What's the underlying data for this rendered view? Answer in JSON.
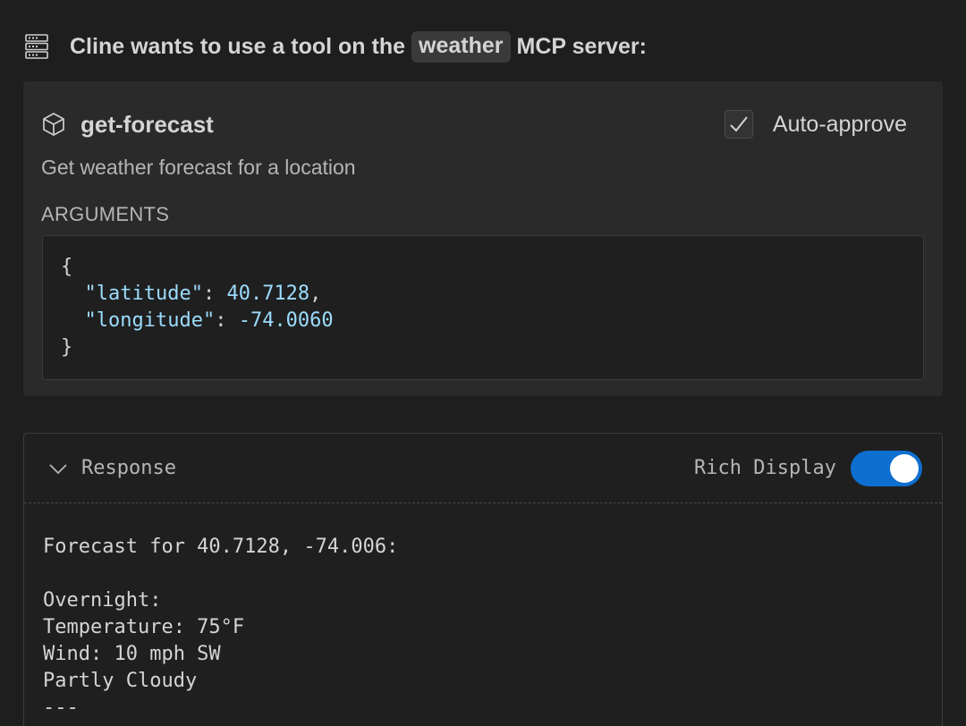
{
  "header": {
    "icon": "server-icon",
    "title_prefix": "Cline wants to use a tool on the",
    "server_name": "weather",
    "title_suffix": "MCP server:"
  },
  "tool": {
    "icon": "cube-icon",
    "name": "get-forecast",
    "description": "Get weather forecast for a location",
    "auto_approve_label": "Auto-approve",
    "auto_approve_checked": true,
    "arguments_label": "ARGUMENTS",
    "arguments": {
      "open": "{",
      "lat_key": "\"latitude\"",
      "lat_value": "40.7128",
      "lon_key": "\"longitude\"",
      "lon_value": "-74.0060",
      "close": "}"
    }
  },
  "response": {
    "title": "Response",
    "rich_display_label": "Rich Display",
    "rich_display_on": true,
    "lines": [
      "Forecast for 40.7128, -74.006:",
      "",
      "Overnight:",
      "Temperature: 75°F",
      "Wind: 10 mph SW",
      "Partly Cloudy",
      "---"
    ]
  },
  "colors": {
    "background": "#1e1e1e",
    "card": "#2a2a2a",
    "accent": "#0e6fd0",
    "code_token": "#9cdcfe"
  }
}
